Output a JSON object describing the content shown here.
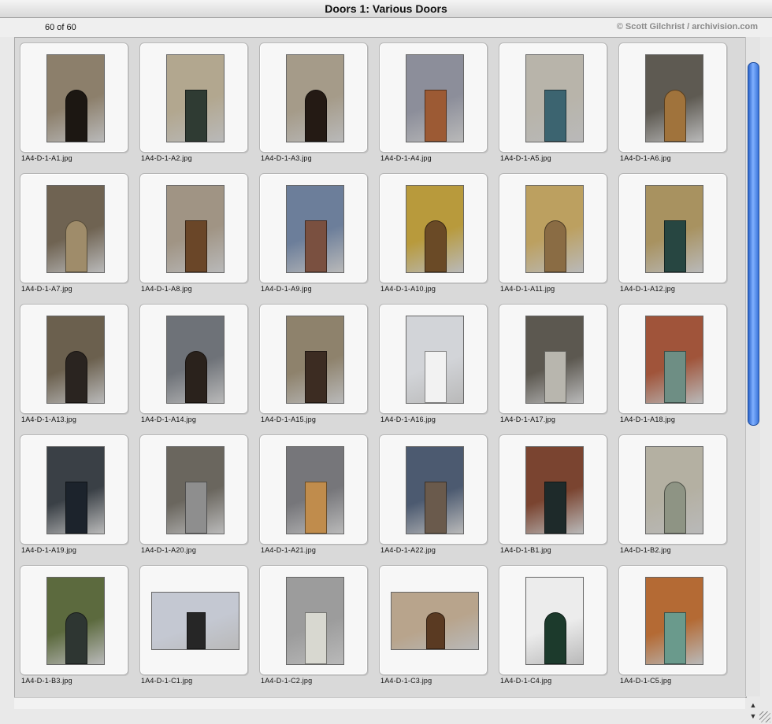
{
  "window": {
    "title": "Doors 1: Various Doors"
  },
  "header": {
    "count": "60 of 60",
    "credit": "© Scott Gilchrist / archivision.com"
  },
  "items": [
    {
      "file": "1A4-D-1-A1.jpg",
      "colors": [
        "#8c7f6b",
        "#1c1712"
      ],
      "orientation": "portrait",
      "arch": true
    },
    {
      "file": "1A4-D-1-A2.jpg",
      "colors": [
        "#b2a78f",
        "#2f3b33"
      ],
      "orientation": "portrait",
      "arch": false
    },
    {
      "file": "1A4-D-1-A3.jpg",
      "colors": [
        "#a59b89",
        "#241a14"
      ],
      "orientation": "portrait",
      "arch": true
    },
    {
      "file": "1A4-D-1-A4.jpg",
      "colors": [
        "#8c8e9a",
        "#9c5a34"
      ],
      "orientation": "portrait",
      "arch": false
    },
    {
      "file": "1A4-D-1-A5.jpg",
      "colors": [
        "#b8b4aa",
        "#3c6470"
      ],
      "orientation": "portrait",
      "arch": false
    },
    {
      "file": "1A4-D-1-A6.jpg",
      "colors": [
        "#5e5a52",
        "#a0733c"
      ],
      "orientation": "portrait",
      "arch": true
    },
    {
      "file": "1A4-D-1-A7.jpg",
      "colors": [
        "#6f6352",
        "#9f8c6a"
      ],
      "orientation": "portrait",
      "arch": true
    },
    {
      "file": "1A4-D-1-A8.jpg",
      "colors": [
        "#a09484",
        "#6a4628"
      ],
      "orientation": "portrait",
      "arch": false
    },
    {
      "file": "1A4-D-1-A9.jpg",
      "colors": [
        "#6c7e9a",
        "#7a5040"
      ],
      "orientation": "portrait",
      "arch": false
    },
    {
      "file": "1A4-D-1-A10.jpg",
      "colors": [
        "#b89a3c",
        "#6a4a26"
      ],
      "orientation": "portrait",
      "arch": true
    },
    {
      "file": "1A4-D-1-A11.jpg",
      "colors": [
        "#bca060",
        "#8a6c44"
      ],
      "orientation": "portrait",
      "arch": true
    },
    {
      "file": "1A4-D-1-A12.jpg",
      "colors": [
        "#a89260",
        "#274641"
      ],
      "orientation": "portrait",
      "arch": false
    },
    {
      "file": "1A4-D-1-A13.jpg",
      "colors": [
        "#6b604e",
        "#2a2420"
      ],
      "orientation": "portrait",
      "arch": true
    },
    {
      "file": "1A4-D-1-A14.jpg",
      "colors": [
        "#6e7278",
        "#2a221c"
      ],
      "orientation": "portrait",
      "arch": true
    },
    {
      "file": "1A4-D-1-A15.jpg",
      "colors": [
        "#8e826c",
        "#3c2c22"
      ],
      "orientation": "portrait",
      "arch": false
    },
    {
      "file": "1A4-D-1-A16.jpg",
      "colors": [
        "#d2d4d8",
        "#f2f2f2"
      ],
      "orientation": "portrait",
      "arch": false
    },
    {
      "file": "1A4-D-1-A17.jpg",
      "colors": [
        "#5c5850",
        "#b8b6ae"
      ],
      "orientation": "portrait",
      "arch": false
    },
    {
      "file": "1A4-D-1-A18.jpg",
      "colors": [
        "#a0543a",
        "#6e8e84"
      ],
      "orientation": "portrait",
      "arch": false
    },
    {
      "file": "1A4-D-1-A19.jpg",
      "colors": [
        "#3a4046",
        "#1c232c"
      ],
      "orientation": "portrait",
      "arch": false
    },
    {
      "file": "1A4-D-1-A20.jpg",
      "colors": [
        "#6a665e",
        "#8e8e8e"
      ],
      "orientation": "portrait",
      "arch": false
    },
    {
      "file": "1A4-D-1-A21.jpg",
      "colors": [
        "#76767a",
        "#c08c4c"
      ],
      "orientation": "portrait",
      "arch": false
    },
    {
      "file": "1A4-D-1-A22.jpg",
      "colors": [
        "#4c5a70",
        "#6a5a4c"
      ],
      "orientation": "portrait",
      "arch": false
    },
    {
      "file": "1A4-D-1-B1.jpg",
      "colors": [
        "#7a4430",
        "#1e2a2a"
      ],
      "orientation": "portrait",
      "arch": false
    },
    {
      "file": "1A4-D-1-B2.jpg",
      "colors": [
        "#b4b0a2",
        "#8e9484"
      ],
      "orientation": "portrait",
      "arch": true
    },
    {
      "file": "1A4-D-1-B3.jpg",
      "colors": [
        "#5c6a3e",
        "#2e3632"
      ],
      "orientation": "portrait",
      "arch": true
    },
    {
      "file": "1A4-D-1-C1.jpg",
      "colors": [
        "#c4c8d2",
        "#262626"
      ],
      "orientation": "landscape",
      "arch": false
    },
    {
      "file": "1A4-D-1-C2.jpg",
      "colors": [
        "#9c9c9c",
        "#d8d8d0"
      ],
      "orientation": "portrait",
      "arch": false
    },
    {
      "file": "1A4-D-1-C3.jpg",
      "colors": [
        "#b8a48c",
        "#5a3a22"
      ],
      "orientation": "landscape",
      "arch": true
    },
    {
      "file": "1A4-D-1-C4.jpg",
      "colors": [
        "#ececec",
        "#1c3a2c"
      ],
      "orientation": "portrait",
      "arch": true
    },
    {
      "file": "1A4-D-1-C5.jpg",
      "colors": [
        "#b46a34",
        "#6a9a8c"
      ],
      "orientation": "portrait",
      "arch": false
    }
  ]
}
